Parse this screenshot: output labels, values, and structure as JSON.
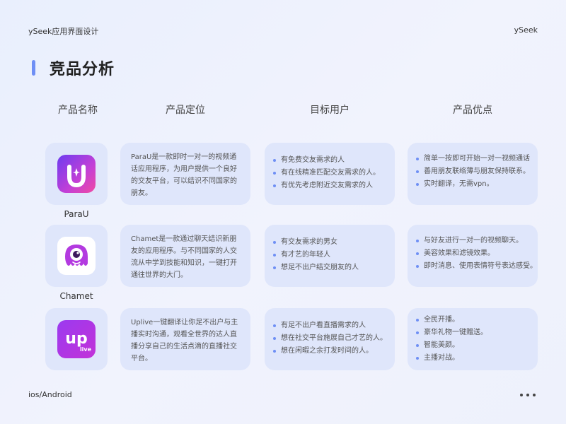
{
  "header": {
    "left_text": "ySeek应用界面设计",
    "right_text": "ySeek"
  },
  "title": "竞品分析",
  "columns": [
    "产品名称",
    "产品定位",
    "目标用户",
    "产品优点"
  ],
  "products": [
    {
      "name": "ParaU",
      "icon": "parau-app-icon",
      "description": "ParaU是一款即时一对一的视频通话应用程序，为用户提供一个良好的交友平台，可以结识不同国家的朋友。",
      "targets": [
        "有免费交友需求的人",
        "有在线精准匹配交友需求的人。",
        "有优先考虑附近交友需求的人"
      ],
      "advantages": [
        "简单一按即可开始一对一视频通话",
        "善用朋友联络薄与朋友保持联系。",
        "实时翻译，无需vpn。"
      ]
    },
    {
      "name": "Chamet",
      "icon": "chamet-app-icon",
      "description": "Chamet是一款通过聊天结识新朋友的应用程序。与不同国家的人交流从中学到技能和知识，一键打开通往世界的大门。",
      "targets": [
        "有交友需求的男女",
        "有才艺的年轻人",
        "想足不出户结交朋友的人"
      ],
      "advantages": [
        "与好友进行一对一的视频聊天。",
        "美容效果和滤镜效果。",
        "即时消息、使用表情符号表达感受。"
      ]
    },
    {
      "name": "",
      "icon": "uplive-app-icon",
      "icon_text": "up",
      "icon_subtext": "live",
      "description": "Uplive一键翻译让你足不出户与主播实时沟通，观看全世界的达人直播分享自己的生活点滴的直播社交平台。",
      "targets": [
        "有足不出户看直播需求的人",
        "想在社交平台施展自己才艺的人。",
        "想在闲暇之余打发时间的人。"
      ],
      "advantages": [
        "全民开播。",
        "豪华礼物一键赠送。",
        "智能美颜。",
        "主播对战。"
      ]
    }
  ],
  "footer": {
    "platform": "ios/Android",
    "more_icon": "more-dots-icon"
  },
  "colors": {
    "accent": "#6f8ff5",
    "card": "#dfe6fb",
    "background": "#eef1fc"
  }
}
